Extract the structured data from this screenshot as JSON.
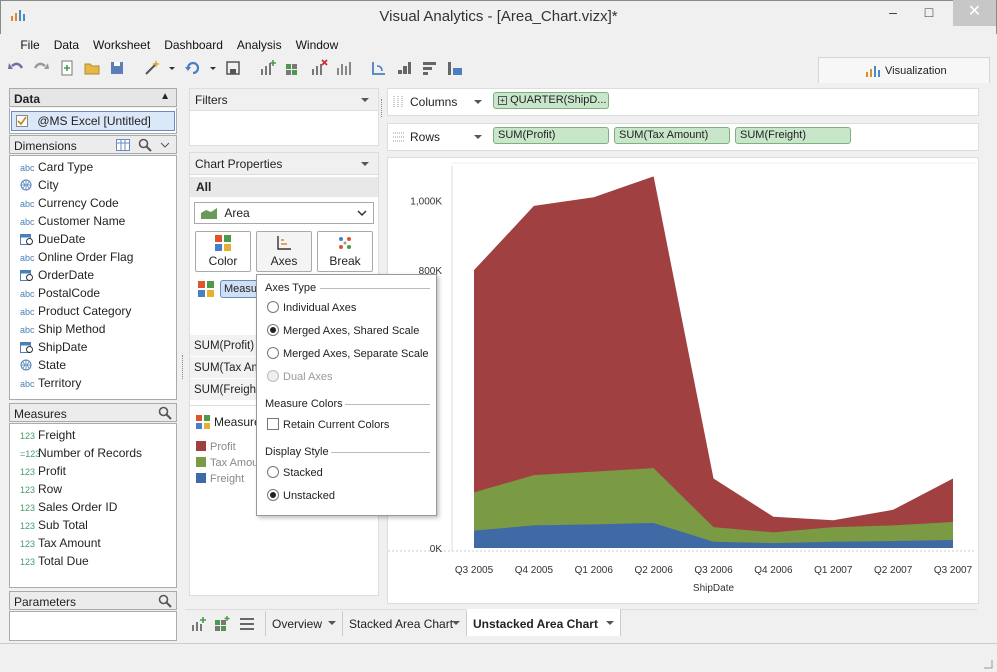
{
  "window": {
    "title": "Visual Analytics - [Area_Chart.vizx]*"
  },
  "menu": [
    "File",
    "Data",
    "Worksheet",
    "Dashboard",
    "Analysis",
    "Window"
  ],
  "vis_tab": {
    "label": "Visualization"
  },
  "data_panel": {
    "title": "Data",
    "source": "@MS Excel [Untitled]",
    "dimensions_title": "Dimensions",
    "dimensions": [
      {
        "type": "abc",
        "label": "Card Type"
      },
      {
        "type": "globe",
        "label": "City"
      },
      {
        "type": "abc",
        "label": "Currency Code"
      },
      {
        "type": "abc",
        "label": "Customer Name"
      },
      {
        "type": "date",
        "label": "DueDate"
      },
      {
        "type": "abc",
        "label": "Online Order Flag"
      },
      {
        "type": "date",
        "label": "OrderDate"
      },
      {
        "type": "abc",
        "label": "PostalCode"
      },
      {
        "type": "abc",
        "label": "Product Category"
      },
      {
        "type": "abc",
        "label": "Ship Method"
      },
      {
        "type": "date",
        "label": "ShipDate"
      },
      {
        "type": "globe",
        "label": "State"
      },
      {
        "type": "abc",
        "label": "Territory"
      }
    ],
    "measures_title": "Measures",
    "measures": [
      {
        "type": "123",
        "label": "Freight"
      },
      {
        "type": "123f",
        "label": "Number of Records"
      },
      {
        "type": "123",
        "label": "Profit"
      },
      {
        "type": "123",
        "label": "Row"
      },
      {
        "type": "123",
        "label": "Sales Order ID"
      },
      {
        "type": "123",
        "label": "Sub Total"
      },
      {
        "type": "123",
        "label": "Tax Amount"
      },
      {
        "type": "123",
        "label": "Total Due"
      }
    ],
    "parameters_title": "Parameters"
  },
  "filters": {
    "title": "Filters"
  },
  "chart_properties": {
    "title": "Chart Properties",
    "all_label": "All",
    "chart_type": "Area",
    "buttons": {
      "color": "Color",
      "axes": "Axes",
      "break": "Break"
    },
    "measure_pill": "Measure",
    "measure_rows": [
      "SUM(Profit)",
      "SUM(Tax Am",
      "SUM(Freight)"
    ],
    "legend_title": "Measure",
    "legend": [
      {
        "label": "Profit",
        "color": "#a04040"
      },
      {
        "label": "Tax Amou",
        "color": "#7a9a44"
      },
      {
        "label": "Freight",
        "color": "#3f6aa5"
      }
    ]
  },
  "shelves": {
    "columns_label": "Columns",
    "columns": [
      "QUARTER(ShipD..."
    ],
    "rows_label": "Rows",
    "rows": [
      "SUM(Profit)",
      "SUM(Tax Amount)",
      "SUM(Freight)"
    ]
  },
  "popup": {
    "axes_type": "Axes Type",
    "options": [
      {
        "label": "Individual Axes",
        "state": "off"
      },
      {
        "label": "Merged Axes, Shared Scale",
        "state": "on"
      },
      {
        "label": "Merged Axes, Separate Scale",
        "state": "off"
      },
      {
        "label": "Dual Axes",
        "state": "disabled"
      }
    ],
    "measure_colors": "Measure Colors",
    "retain": "Retain Current Colors",
    "display_style": "Display Style",
    "styles": [
      {
        "label": "Stacked",
        "state": "off"
      },
      {
        "label": "Unstacked",
        "state": "on"
      }
    ]
  },
  "sheet_tabs": [
    {
      "label": "Overview",
      "active": false
    },
    {
      "label": "Stacked Area Chart",
      "active": false
    },
    {
      "label": "Unstacked Area Chart",
      "active": true
    }
  ],
  "chart_data": {
    "type": "area",
    "stacked": false,
    "categories": [
      "Q3 2005",
      "Q4 2005",
      "Q1 2006",
      "Q2 2006",
      "Q3 2006",
      "Q4 2006",
      "Q1 2007",
      "Q2 2007",
      "Q3 2007"
    ],
    "xlabel": "ShipDate",
    "ylabel": "",
    "ylim": [
      0,
      1100000
    ],
    "visible_ticks": [
      {
        "v": 0,
        "label": "0K"
      },
      {
        "v": 800000,
        "label": "800K"
      },
      {
        "v": 1000000,
        "label": "1,000K"
      }
    ],
    "series": [
      {
        "name": "Profit",
        "color": "#a04040",
        "values": [
          800000,
          985000,
          1010000,
          1070000,
          200000,
          90000,
          80000,
          110000,
          200000
        ]
      },
      {
        "name": "Tax Amount",
        "color": "#7a9a44",
        "values": [
          160000,
          210000,
          220000,
          230000,
          60000,
          45000,
          60000,
          65000,
          75000
        ]
      },
      {
        "name": "Freight",
        "color": "#3f6aa5",
        "values": [
          50000,
          65000,
          68000,
          72000,
          18000,
          14000,
          18000,
          20000,
          23000
        ]
      }
    ]
  }
}
